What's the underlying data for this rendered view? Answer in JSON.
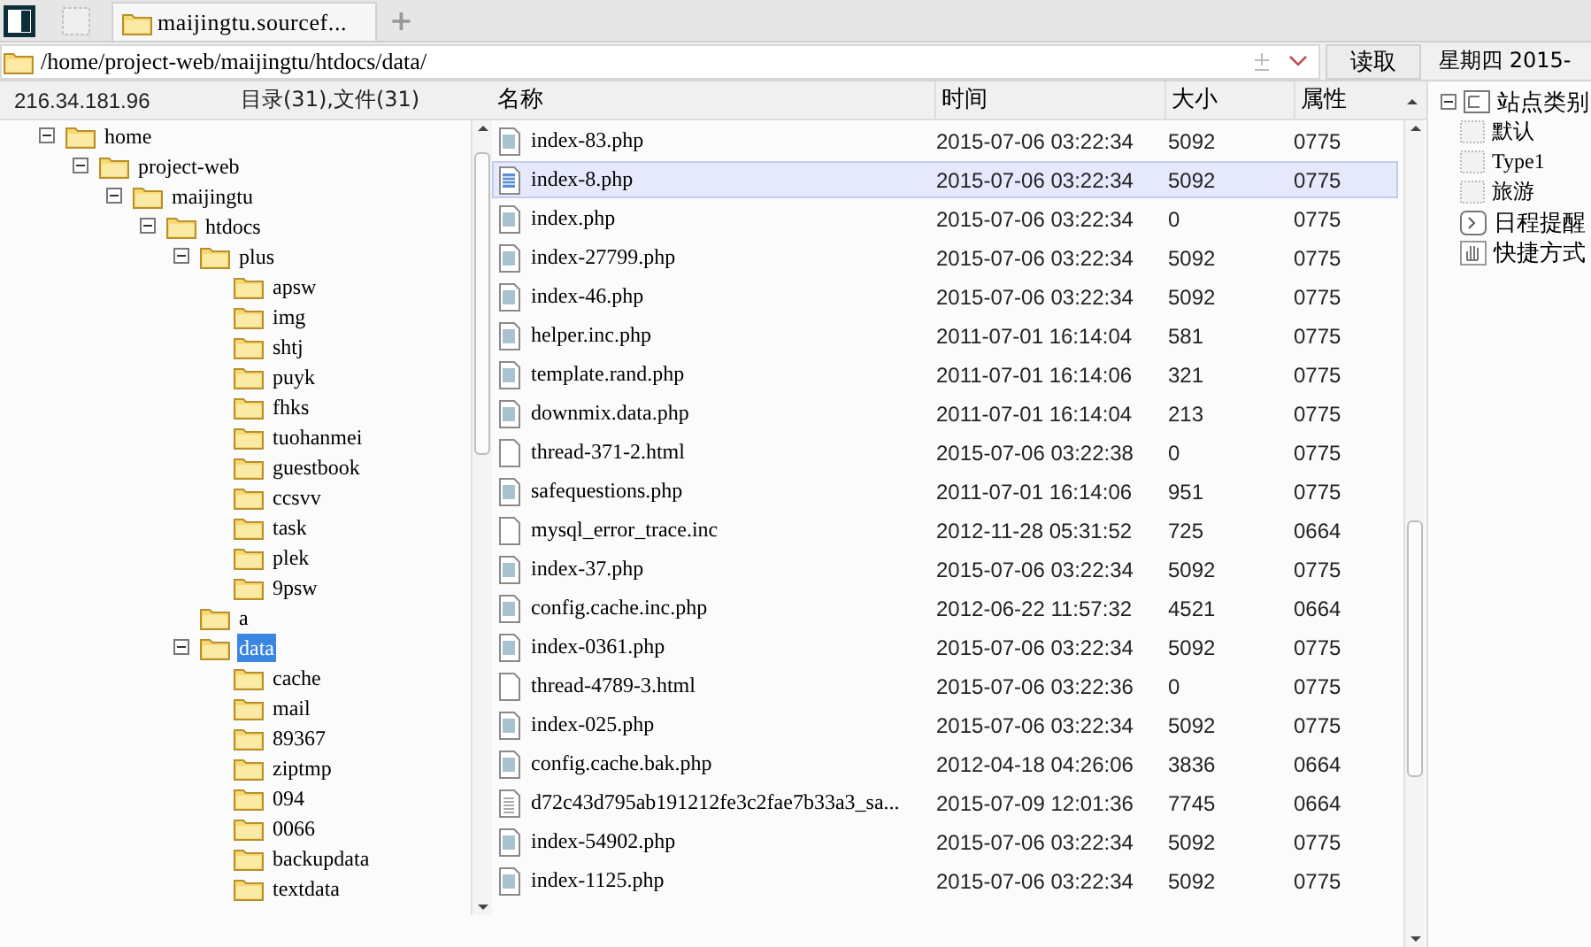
{
  "tabs": [
    {
      "label": "maijingtu.sourcef...",
      "selected": true
    }
  ],
  "new_tab": "+",
  "address": {
    "value": "/home/project-web/maijingtu/htdocs/data/"
  },
  "read_button": "读取",
  "date": "星期四 2015-",
  "host": "216.34.181.96",
  "summary": "目录(31),文件(31)",
  "tree": [
    {
      "label": "home",
      "selected": false,
      "expanded": true,
      "children": [
        {
          "label": "project-web",
          "selected": false,
          "expanded": true,
          "children": [
            {
              "label": "maijingtu",
              "selected": false,
              "expanded": true,
              "children": [
                {
                  "label": "htdocs",
                  "selected": false,
                  "expanded": true,
                  "children": [
                    {
                      "label": "plus",
                      "selected": false,
                      "expanded": true,
                      "children": [
                        {
                          "label": "apsw",
                          "selected": false
                        },
                        {
                          "label": "img",
                          "selected": false
                        },
                        {
                          "label": "shtj",
                          "selected": false
                        },
                        {
                          "label": "puyk",
                          "selected": false
                        },
                        {
                          "label": "fhks",
                          "selected": false
                        },
                        {
                          "label": "tuohanmei",
                          "selected": false
                        },
                        {
                          "label": "guestbook",
                          "selected": false
                        },
                        {
                          "label": "ccsvv",
                          "selected": false
                        },
                        {
                          "label": "task",
                          "selected": false
                        },
                        {
                          "label": "plek",
                          "selected": false
                        },
                        {
                          "label": "9psw",
                          "selected": false
                        }
                      ]
                    },
                    {
                      "label": "a",
                      "selected": false
                    },
                    {
                      "label": "data",
                      "selected": true,
                      "expanded": true,
                      "children": [
                        {
                          "label": "cache",
                          "selected": false
                        },
                        {
                          "label": "mail",
                          "selected": false
                        },
                        {
                          "label": "89367",
                          "selected": false
                        },
                        {
                          "label": "ziptmp",
                          "selected": false
                        },
                        {
                          "label": "094",
                          "selected": false
                        },
                        {
                          "label": "0066",
                          "selected": false
                        },
                        {
                          "label": "backupdata",
                          "selected": false
                        },
                        {
                          "label": "textdata",
                          "selected": false
                        }
                      ]
                    }
                  ]
                }
              ]
            }
          ]
        }
      ]
    }
  ],
  "file_list": {
    "columns": [
      "名称",
      "时间",
      "大小",
      "属性"
    ],
    "rows": [
      {
        "name": "index-83.php",
        "time": "2015-07-06 03:22:34",
        "size": "5092",
        "attr": "0775",
        "kind": "php",
        "selected": false
      },
      {
        "name": "index-8.php",
        "time": "2015-07-06 03:22:34",
        "size": "5092",
        "attr": "0775",
        "kind": "php",
        "selected": true
      },
      {
        "name": "index.php",
        "time": "2015-07-06 03:22:34",
        "size": "0",
        "attr": "0775",
        "kind": "php",
        "selected": false
      },
      {
        "name": "index-27799.php",
        "time": "2015-07-06 03:22:34",
        "size": "5092",
        "attr": "0775",
        "kind": "php",
        "selected": false
      },
      {
        "name": "index-46.php",
        "time": "2015-07-06 03:22:34",
        "size": "5092",
        "attr": "0775",
        "kind": "php",
        "selected": false
      },
      {
        "name": "helper.inc.php",
        "time": "2011-07-01 16:14:04",
        "size": "581",
        "attr": "0775",
        "kind": "php",
        "selected": false
      },
      {
        "name": "template.rand.php",
        "time": "2011-07-01 16:14:06",
        "size": "321",
        "attr": "0775",
        "kind": "php",
        "selected": false
      },
      {
        "name": "downmix.data.php",
        "time": "2011-07-01 16:14:04",
        "size": "213",
        "attr": "0775",
        "kind": "php",
        "selected": false
      },
      {
        "name": "thread-371-2.html",
        "time": "2015-07-06 03:22:38",
        "size": "0",
        "attr": "0775",
        "kind": "blank",
        "selected": false
      },
      {
        "name": "safequestions.php",
        "time": "2011-07-01 16:14:06",
        "size": "951",
        "attr": "0775",
        "kind": "php",
        "selected": false
      },
      {
        "name": "mysql_error_trace.inc",
        "time": "2012-11-28 05:31:52",
        "size": "725",
        "attr": "0664",
        "kind": "blank",
        "selected": false
      },
      {
        "name": "index-37.php",
        "time": "2015-07-06 03:22:34",
        "size": "5092",
        "attr": "0775",
        "kind": "php",
        "selected": false
      },
      {
        "name": "config.cache.inc.php",
        "time": "2012-06-22 11:57:32",
        "size": "4521",
        "attr": "0664",
        "kind": "php",
        "selected": false
      },
      {
        "name": "index-0361.php",
        "time": "2015-07-06 03:22:34",
        "size": "5092",
        "attr": "0775",
        "kind": "php",
        "selected": false
      },
      {
        "name": "thread-4789-3.html",
        "time": "2015-07-06 03:22:36",
        "size": "0",
        "attr": "0775",
        "kind": "blank",
        "selected": false
      },
      {
        "name": "index-025.php",
        "time": "2015-07-06 03:22:34",
        "size": "5092",
        "attr": "0775",
        "kind": "php",
        "selected": false
      },
      {
        "name": "config.cache.bak.php",
        "time": "2012-04-18 04:26:06",
        "size": "3836",
        "attr": "0664",
        "kind": "php",
        "selected": false
      },
      {
        "name": "d72c43d795ab191212fe3c2fae7b33a3_sa...",
        "time": "2015-07-09 12:01:36",
        "size": "7745",
        "attr": "0664",
        "kind": "text",
        "selected": false
      },
      {
        "name": "index-54902.php",
        "time": "2015-07-06 03:22:34",
        "size": "5092",
        "attr": "0775",
        "kind": "php",
        "selected": false
      },
      {
        "name": "index-1125.php",
        "time": "2015-07-06 03:22:34",
        "size": "5092",
        "attr": "0775",
        "kind": "php",
        "selected": false
      }
    ]
  },
  "side_tree": [
    {
      "label": "站点类别",
      "kind": "category",
      "expanded": true,
      "children": [
        {
          "label": "默认",
          "kind": "type"
        },
        {
          "label": "Type1",
          "kind": "type"
        },
        {
          "label": "旅游",
          "kind": "type"
        }
      ]
    },
    {
      "label": "日程提醒",
      "kind": "reminder"
    },
    {
      "label": "快捷方式",
      "kind": "shortcut"
    }
  ]
}
